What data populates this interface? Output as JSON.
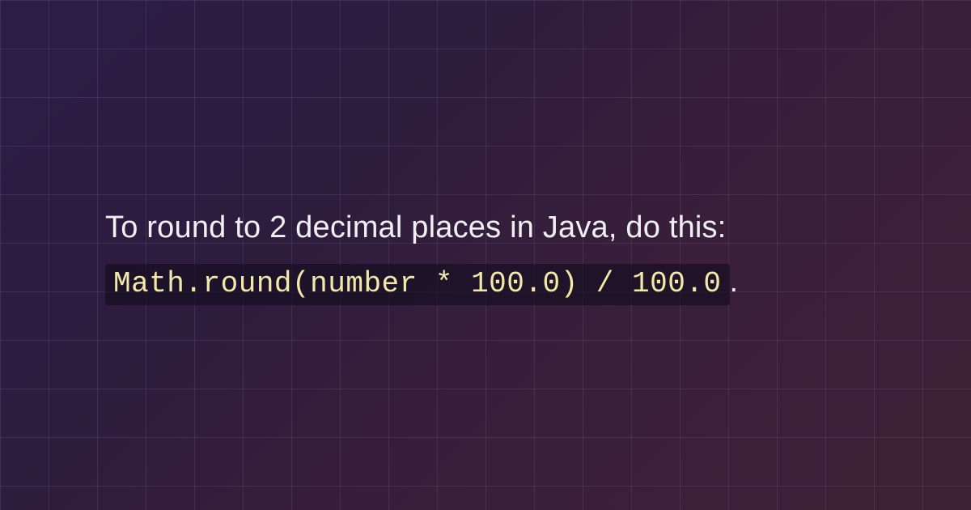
{
  "content": {
    "intro_text": "To round to 2 decimal places in Java, do this: ",
    "code_snippet": "Math.round(number * 100.0) / 100.0",
    "trailing_text": "."
  }
}
